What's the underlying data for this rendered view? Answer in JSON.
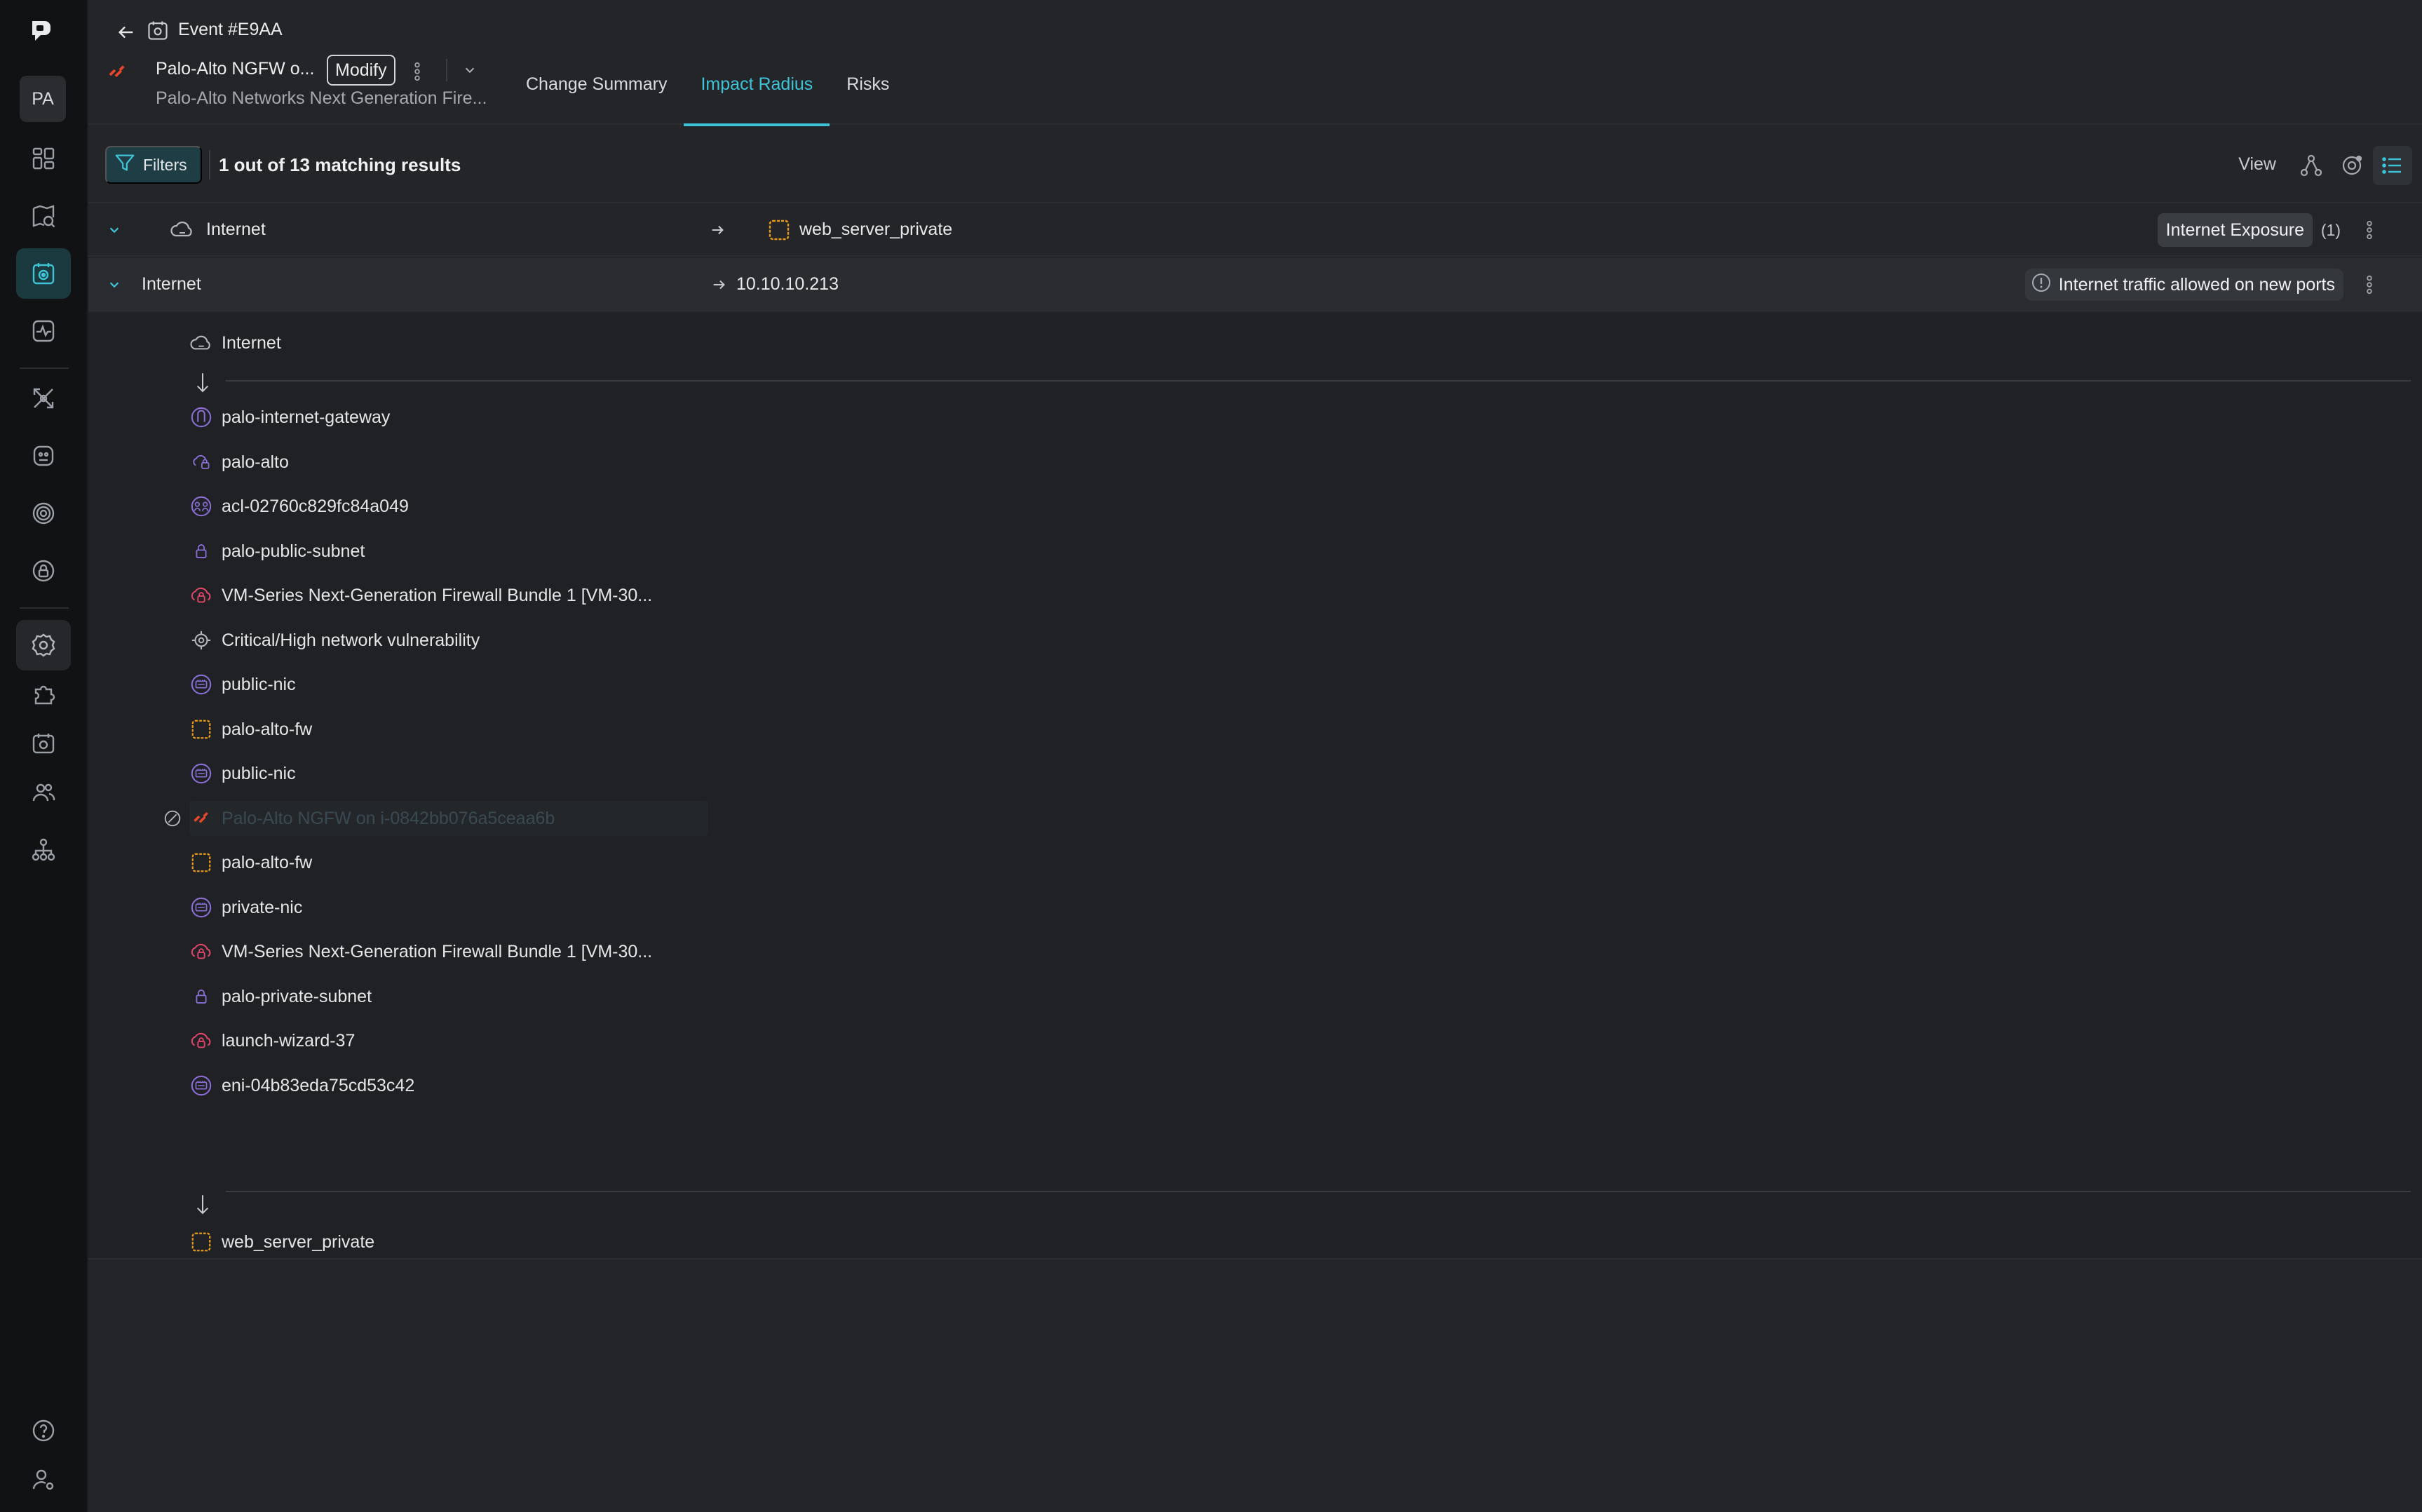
{
  "rail": {
    "avatar": "PA"
  },
  "header": {
    "event_title": "Event #E9AA",
    "resource_name": "Palo-Alto NGFW o...",
    "modify_label": "Modify",
    "resource_subtitle": "Palo-Alto Networks Next Generation Fire...",
    "tabs": [
      {
        "label": "Change Summary"
      },
      {
        "label": "Impact Radius"
      },
      {
        "label": "Risks"
      }
    ]
  },
  "toolbar": {
    "filters_label": "Filters",
    "results_text": "1 out of 13 matching results",
    "view_label": "View"
  },
  "row_a": {
    "source": "Internet",
    "target": "web_server_private",
    "tag": "Internet Exposure",
    "count": "(1)"
  },
  "row_b": {
    "source": "Internet",
    "target": "10.10.10.213",
    "risk": "Internet traffic allowed on new ports"
  },
  "path": {
    "start": "Internet",
    "items": [
      {
        "label": "palo-internet-gateway",
        "icon": "gateway-icon"
      },
      {
        "label": "palo-alto",
        "icon": "cloud-lock-icon"
      },
      {
        "label": "acl-02760c829fc84a049",
        "icon": "acl-icon"
      },
      {
        "label": "palo-public-subnet",
        "icon": "lock-icon"
      },
      {
        "label": "VM-Series Next-Generation Firewall Bundle 1 [VM-30...",
        "icon": "security-group-icon"
      },
      {
        "label": "Critical/High network vulnerability",
        "icon": "vulnerability-icon"
      },
      {
        "label": "public-nic",
        "icon": "nic-icon"
      },
      {
        "label": "palo-alto-fw",
        "icon": "instance-icon"
      },
      {
        "label": "public-nic",
        "icon": "nic-icon"
      },
      {
        "label": "Palo-Alto NGFW on i-0842bb076a5ceaa6b",
        "icon": "palo-alto-logo-icon",
        "disabled": true
      },
      {
        "label": "palo-alto-fw",
        "icon": "instance-icon"
      },
      {
        "label": "private-nic",
        "icon": "nic-icon"
      },
      {
        "label": "VM-Series Next-Generation Firewall Bundle 1 [VM-30...",
        "icon": "security-group-icon"
      },
      {
        "label": "palo-private-subnet",
        "icon": "lock-icon"
      },
      {
        "label": "launch-wizard-37",
        "icon": "security-group-icon"
      },
      {
        "label": "eni-04b83eda75cd53c42",
        "icon": "nic-icon"
      }
    ],
    "end": "web_server_private"
  },
  "colors": {
    "accent": "#3fc3d6",
    "instance": "#e89a1c",
    "nic": "#8b6fd6",
    "security_group": "#e0456a",
    "brand": "#e8472b"
  }
}
